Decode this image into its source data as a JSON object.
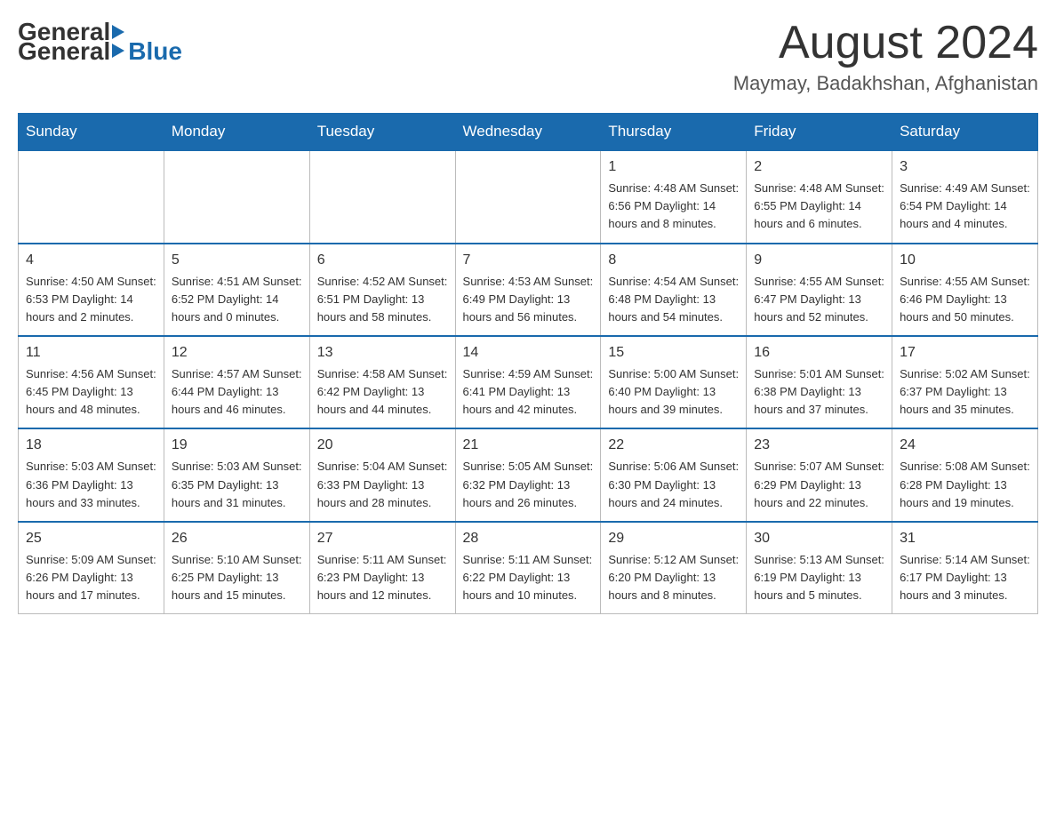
{
  "header": {
    "logo": {
      "general": "General",
      "blue": "Blue"
    },
    "title": "August 2024",
    "location": "Maymay, Badakhshan, Afghanistan"
  },
  "calendar": {
    "days": [
      "Sunday",
      "Monday",
      "Tuesday",
      "Wednesday",
      "Thursday",
      "Friday",
      "Saturday"
    ],
    "weeks": [
      [
        {
          "day": "",
          "info": ""
        },
        {
          "day": "",
          "info": ""
        },
        {
          "day": "",
          "info": ""
        },
        {
          "day": "",
          "info": ""
        },
        {
          "day": "1",
          "info": "Sunrise: 4:48 AM\nSunset: 6:56 PM\nDaylight: 14 hours\nand 8 minutes."
        },
        {
          "day": "2",
          "info": "Sunrise: 4:48 AM\nSunset: 6:55 PM\nDaylight: 14 hours\nand 6 minutes."
        },
        {
          "day": "3",
          "info": "Sunrise: 4:49 AM\nSunset: 6:54 PM\nDaylight: 14 hours\nand 4 minutes."
        }
      ],
      [
        {
          "day": "4",
          "info": "Sunrise: 4:50 AM\nSunset: 6:53 PM\nDaylight: 14 hours\nand 2 minutes."
        },
        {
          "day": "5",
          "info": "Sunrise: 4:51 AM\nSunset: 6:52 PM\nDaylight: 14 hours\nand 0 minutes."
        },
        {
          "day": "6",
          "info": "Sunrise: 4:52 AM\nSunset: 6:51 PM\nDaylight: 13 hours\nand 58 minutes."
        },
        {
          "day": "7",
          "info": "Sunrise: 4:53 AM\nSunset: 6:49 PM\nDaylight: 13 hours\nand 56 minutes."
        },
        {
          "day": "8",
          "info": "Sunrise: 4:54 AM\nSunset: 6:48 PM\nDaylight: 13 hours\nand 54 minutes."
        },
        {
          "day": "9",
          "info": "Sunrise: 4:55 AM\nSunset: 6:47 PM\nDaylight: 13 hours\nand 52 minutes."
        },
        {
          "day": "10",
          "info": "Sunrise: 4:55 AM\nSunset: 6:46 PM\nDaylight: 13 hours\nand 50 minutes."
        }
      ],
      [
        {
          "day": "11",
          "info": "Sunrise: 4:56 AM\nSunset: 6:45 PM\nDaylight: 13 hours\nand 48 minutes."
        },
        {
          "day": "12",
          "info": "Sunrise: 4:57 AM\nSunset: 6:44 PM\nDaylight: 13 hours\nand 46 minutes."
        },
        {
          "day": "13",
          "info": "Sunrise: 4:58 AM\nSunset: 6:42 PM\nDaylight: 13 hours\nand 44 minutes."
        },
        {
          "day": "14",
          "info": "Sunrise: 4:59 AM\nSunset: 6:41 PM\nDaylight: 13 hours\nand 42 minutes."
        },
        {
          "day": "15",
          "info": "Sunrise: 5:00 AM\nSunset: 6:40 PM\nDaylight: 13 hours\nand 39 minutes."
        },
        {
          "day": "16",
          "info": "Sunrise: 5:01 AM\nSunset: 6:38 PM\nDaylight: 13 hours\nand 37 minutes."
        },
        {
          "day": "17",
          "info": "Sunrise: 5:02 AM\nSunset: 6:37 PM\nDaylight: 13 hours\nand 35 minutes."
        }
      ],
      [
        {
          "day": "18",
          "info": "Sunrise: 5:03 AM\nSunset: 6:36 PM\nDaylight: 13 hours\nand 33 minutes."
        },
        {
          "day": "19",
          "info": "Sunrise: 5:03 AM\nSunset: 6:35 PM\nDaylight: 13 hours\nand 31 minutes."
        },
        {
          "day": "20",
          "info": "Sunrise: 5:04 AM\nSunset: 6:33 PM\nDaylight: 13 hours\nand 28 minutes."
        },
        {
          "day": "21",
          "info": "Sunrise: 5:05 AM\nSunset: 6:32 PM\nDaylight: 13 hours\nand 26 minutes."
        },
        {
          "day": "22",
          "info": "Sunrise: 5:06 AM\nSunset: 6:30 PM\nDaylight: 13 hours\nand 24 minutes."
        },
        {
          "day": "23",
          "info": "Sunrise: 5:07 AM\nSunset: 6:29 PM\nDaylight: 13 hours\nand 22 minutes."
        },
        {
          "day": "24",
          "info": "Sunrise: 5:08 AM\nSunset: 6:28 PM\nDaylight: 13 hours\nand 19 minutes."
        }
      ],
      [
        {
          "day": "25",
          "info": "Sunrise: 5:09 AM\nSunset: 6:26 PM\nDaylight: 13 hours\nand 17 minutes."
        },
        {
          "day": "26",
          "info": "Sunrise: 5:10 AM\nSunset: 6:25 PM\nDaylight: 13 hours\nand 15 minutes."
        },
        {
          "day": "27",
          "info": "Sunrise: 5:11 AM\nSunset: 6:23 PM\nDaylight: 13 hours\nand 12 minutes."
        },
        {
          "day": "28",
          "info": "Sunrise: 5:11 AM\nSunset: 6:22 PM\nDaylight: 13 hours\nand 10 minutes."
        },
        {
          "day": "29",
          "info": "Sunrise: 5:12 AM\nSunset: 6:20 PM\nDaylight: 13 hours\nand 8 minutes."
        },
        {
          "day": "30",
          "info": "Sunrise: 5:13 AM\nSunset: 6:19 PM\nDaylight: 13 hours\nand 5 minutes."
        },
        {
          "day": "31",
          "info": "Sunrise: 5:14 AM\nSunset: 6:17 PM\nDaylight: 13 hours\nand 3 minutes."
        }
      ]
    ]
  }
}
